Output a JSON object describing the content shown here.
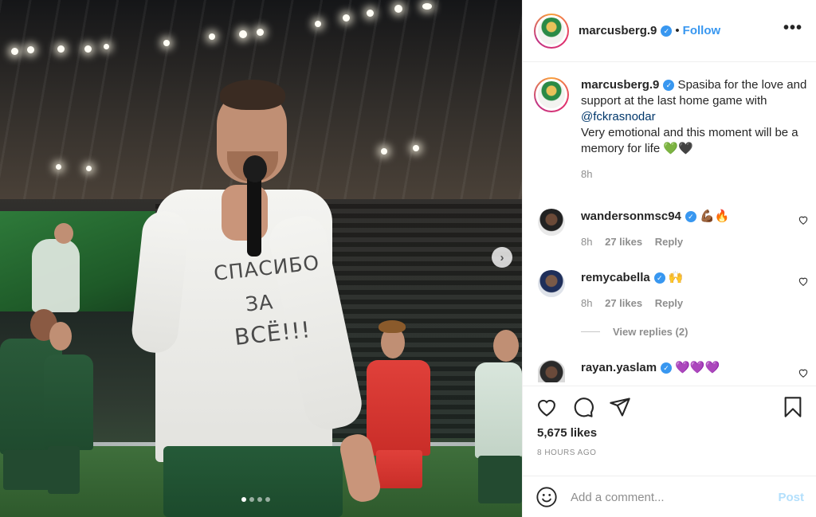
{
  "post": {
    "username": "marcusberg.9",
    "follow_label": "Follow",
    "separator": "•",
    "more_icon": "more-horizontal-icon",
    "shirt_text": {
      "line1": "СПАСИБО",
      "line2": "ЗА",
      "line3": "ВСЁ!!!"
    },
    "nav_arrow": "›",
    "carousel": {
      "total": 4,
      "active": 1
    }
  },
  "caption": {
    "username": "marcusberg.9",
    "text_before_mention": " Spasiba for the love and support at the last home game with ",
    "mention": "@fckrasnodar",
    "text_after": "Very emotional and this moment will be a memory for life ",
    "emoji": "💚🖤",
    "time": "8h"
  },
  "comments": [
    {
      "username": "wandersonmsc94",
      "text": "💪🏾🔥",
      "time": "8h",
      "likes": "27 likes",
      "reply": "Reply"
    },
    {
      "username": "remycabella",
      "text": "🙌",
      "time": "8h",
      "likes": "27 likes",
      "reply": "Reply",
      "view_replies": "View replies (2)"
    },
    {
      "username": "rayan.yaslam",
      "text": "💜💜💜"
    }
  ],
  "footer": {
    "likes": "5,675 likes",
    "time_ago": "8 HOURS AGO",
    "comment_placeholder": "Add a comment...",
    "post_label": "Post"
  },
  "colors": {
    "link": "#3897f0",
    "verified": "#3897f0",
    "muted": "#8e8e8e",
    "post_disabled": "#b2dffc"
  }
}
